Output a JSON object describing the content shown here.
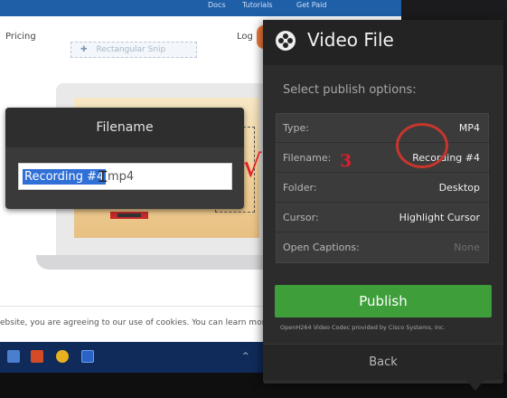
{
  "background_site": {
    "top_strip": [
      "Docs",
      "Tutorials",
      "Get Paid"
    ],
    "nav_pricing": "Pricing",
    "nav_login": "Log In",
    "snip_label": "Rectangular Snip",
    "cookie_text": "ebsite, you are agreeing to our use of cookies. You can learn more"
  },
  "filename_dialog": {
    "title": "Filename",
    "selected_text": "Recording #4",
    "rest_text": "mp4"
  },
  "annotations": {
    "check": "√",
    "number": "3"
  },
  "video_file_panel": {
    "title": "Video File",
    "subtitle": "Select publish options:",
    "options": [
      {
        "label": "Type:",
        "value": "MP4"
      },
      {
        "label": "Filename:",
        "value": "Recording #4"
      },
      {
        "label": "Folder:",
        "value": "Desktop"
      },
      {
        "label": "Cursor:",
        "value": "Highlight Cursor"
      },
      {
        "label": "Open Captions:",
        "value": "None"
      }
    ],
    "publish_label": "Publish",
    "codec_note": "OpenH264 Video Codec provided by Cisco Systems, Inc.",
    "back_label": "Back"
  },
  "taskbar": {
    "icons": [
      "people-icon",
      "office-icon",
      "chrome-icon",
      "app-icon"
    ],
    "tray": "^"
  },
  "colors": {
    "publish_green": "#3e9e3a",
    "selection_blue": "#2f6fd6",
    "annotation_red": "#e11d2a"
  }
}
